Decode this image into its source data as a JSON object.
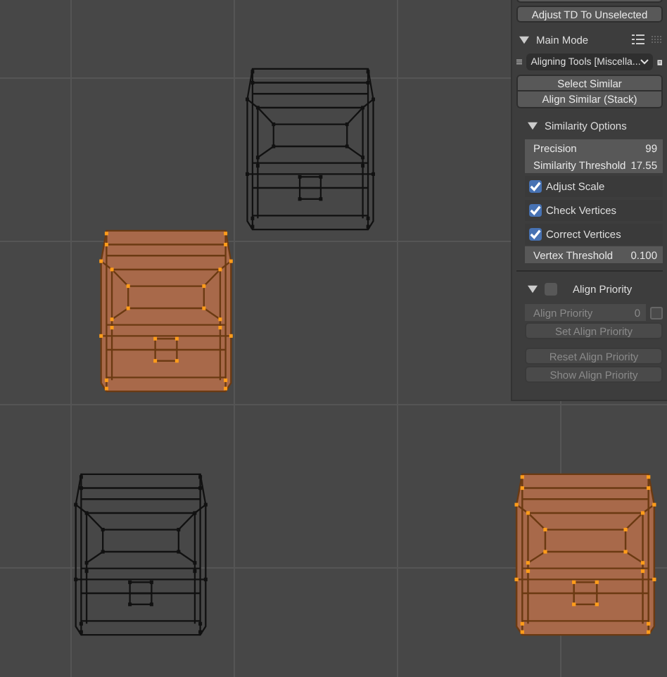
{
  "viewport": {
    "objects": [
      {
        "selected": false
      },
      {
        "selected": true
      },
      {
        "selected": false
      },
      {
        "selected": true
      }
    ]
  },
  "panel": {
    "top_button": "Adjust TD To Unselected",
    "main_mode": {
      "label": "Main Mode",
      "expanded": true
    },
    "tool_dropdown": "Aligning Tools [Miscella...",
    "buttons": [
      "Select Similar",
      "Align Similar (Stack)"
    ],
    "similarity_options": {
      "label": "Similarity Options",
      "expanded": true,
      "fields": [
        {
          "label": "Precision",
          "value": "99"
        },
        {
          "label": "Similarity Threshold",
          "value": "17.55"
        }
      ],
      "checkboxes": [
        {
          "label": "Adjust Scale",
          "checked": true
        },
        {
          "label": "Check Vertices",
          "checked": true
        },
        {
          "label": "Correct Vertices",
          "checked": true
        }
      ],
      "vertex_threshold": {
        "label": "Vertex Threshold",
        "value": "0.100"
      }
    },
    "align_priority": {
      "label": "Align Priority",
      "expanded": true,
      "checked": false,
      "field": {
        "label": "Align Priority",
        "value": "0",
        "disabled": true
      },
      "buttons": [
        {
          "label": "Set Align Priority",
          "disabled": true
        },
        {
          "label": "Reset Align Priority",
          "disabled": true
        },
        {
          "label": "Show Align Priority",
          "disabled": true
        }
      ]
    }
  }
}
